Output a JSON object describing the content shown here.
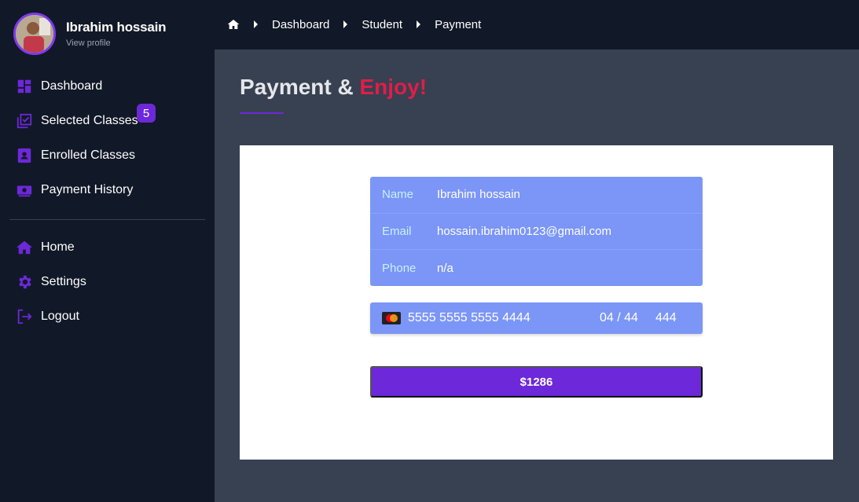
{
  "profile": {
    "name": "Ibrahim hossain",
    "link": "View profile"
  },
  "nav": {
    "dashboard": "Dashboard",
    "selected": "Selected Classes",
    "selected_badge": "5",
    "enrolled": "Enrolled Classes",
    "history": "Payment History",
    "home": "Home",
    "settings": "Settings",
    "logout": "Logout"
  },
  "breadcrumb": [
    "Dashboard",
    "Student",
    "Payment"
  ],
  "page": {
    "title_main": "Payment &",
    "title_accent": "Enjoy!"
  },
  "info": {
    "name_key": "Name",
    "name_val": "Ibrahim hossain",
    "email_key": "Email",
    "email_val": "hossain.ibrahim0123@gmail.com",
    "phone_key": "Phone",
    "phone_val": "n/a"
  },
  "card": {
    "number": "5555 5555 5555 4444",
    "expiry": "04 / 44",
    "cvc": "444"
  },
  "pay_button": "$1286",
  "colors": {
    "accent": "#6d28d9",
    "highlight": "#e11d48",
    "info_bg": "#7b96f6"
  }
}
